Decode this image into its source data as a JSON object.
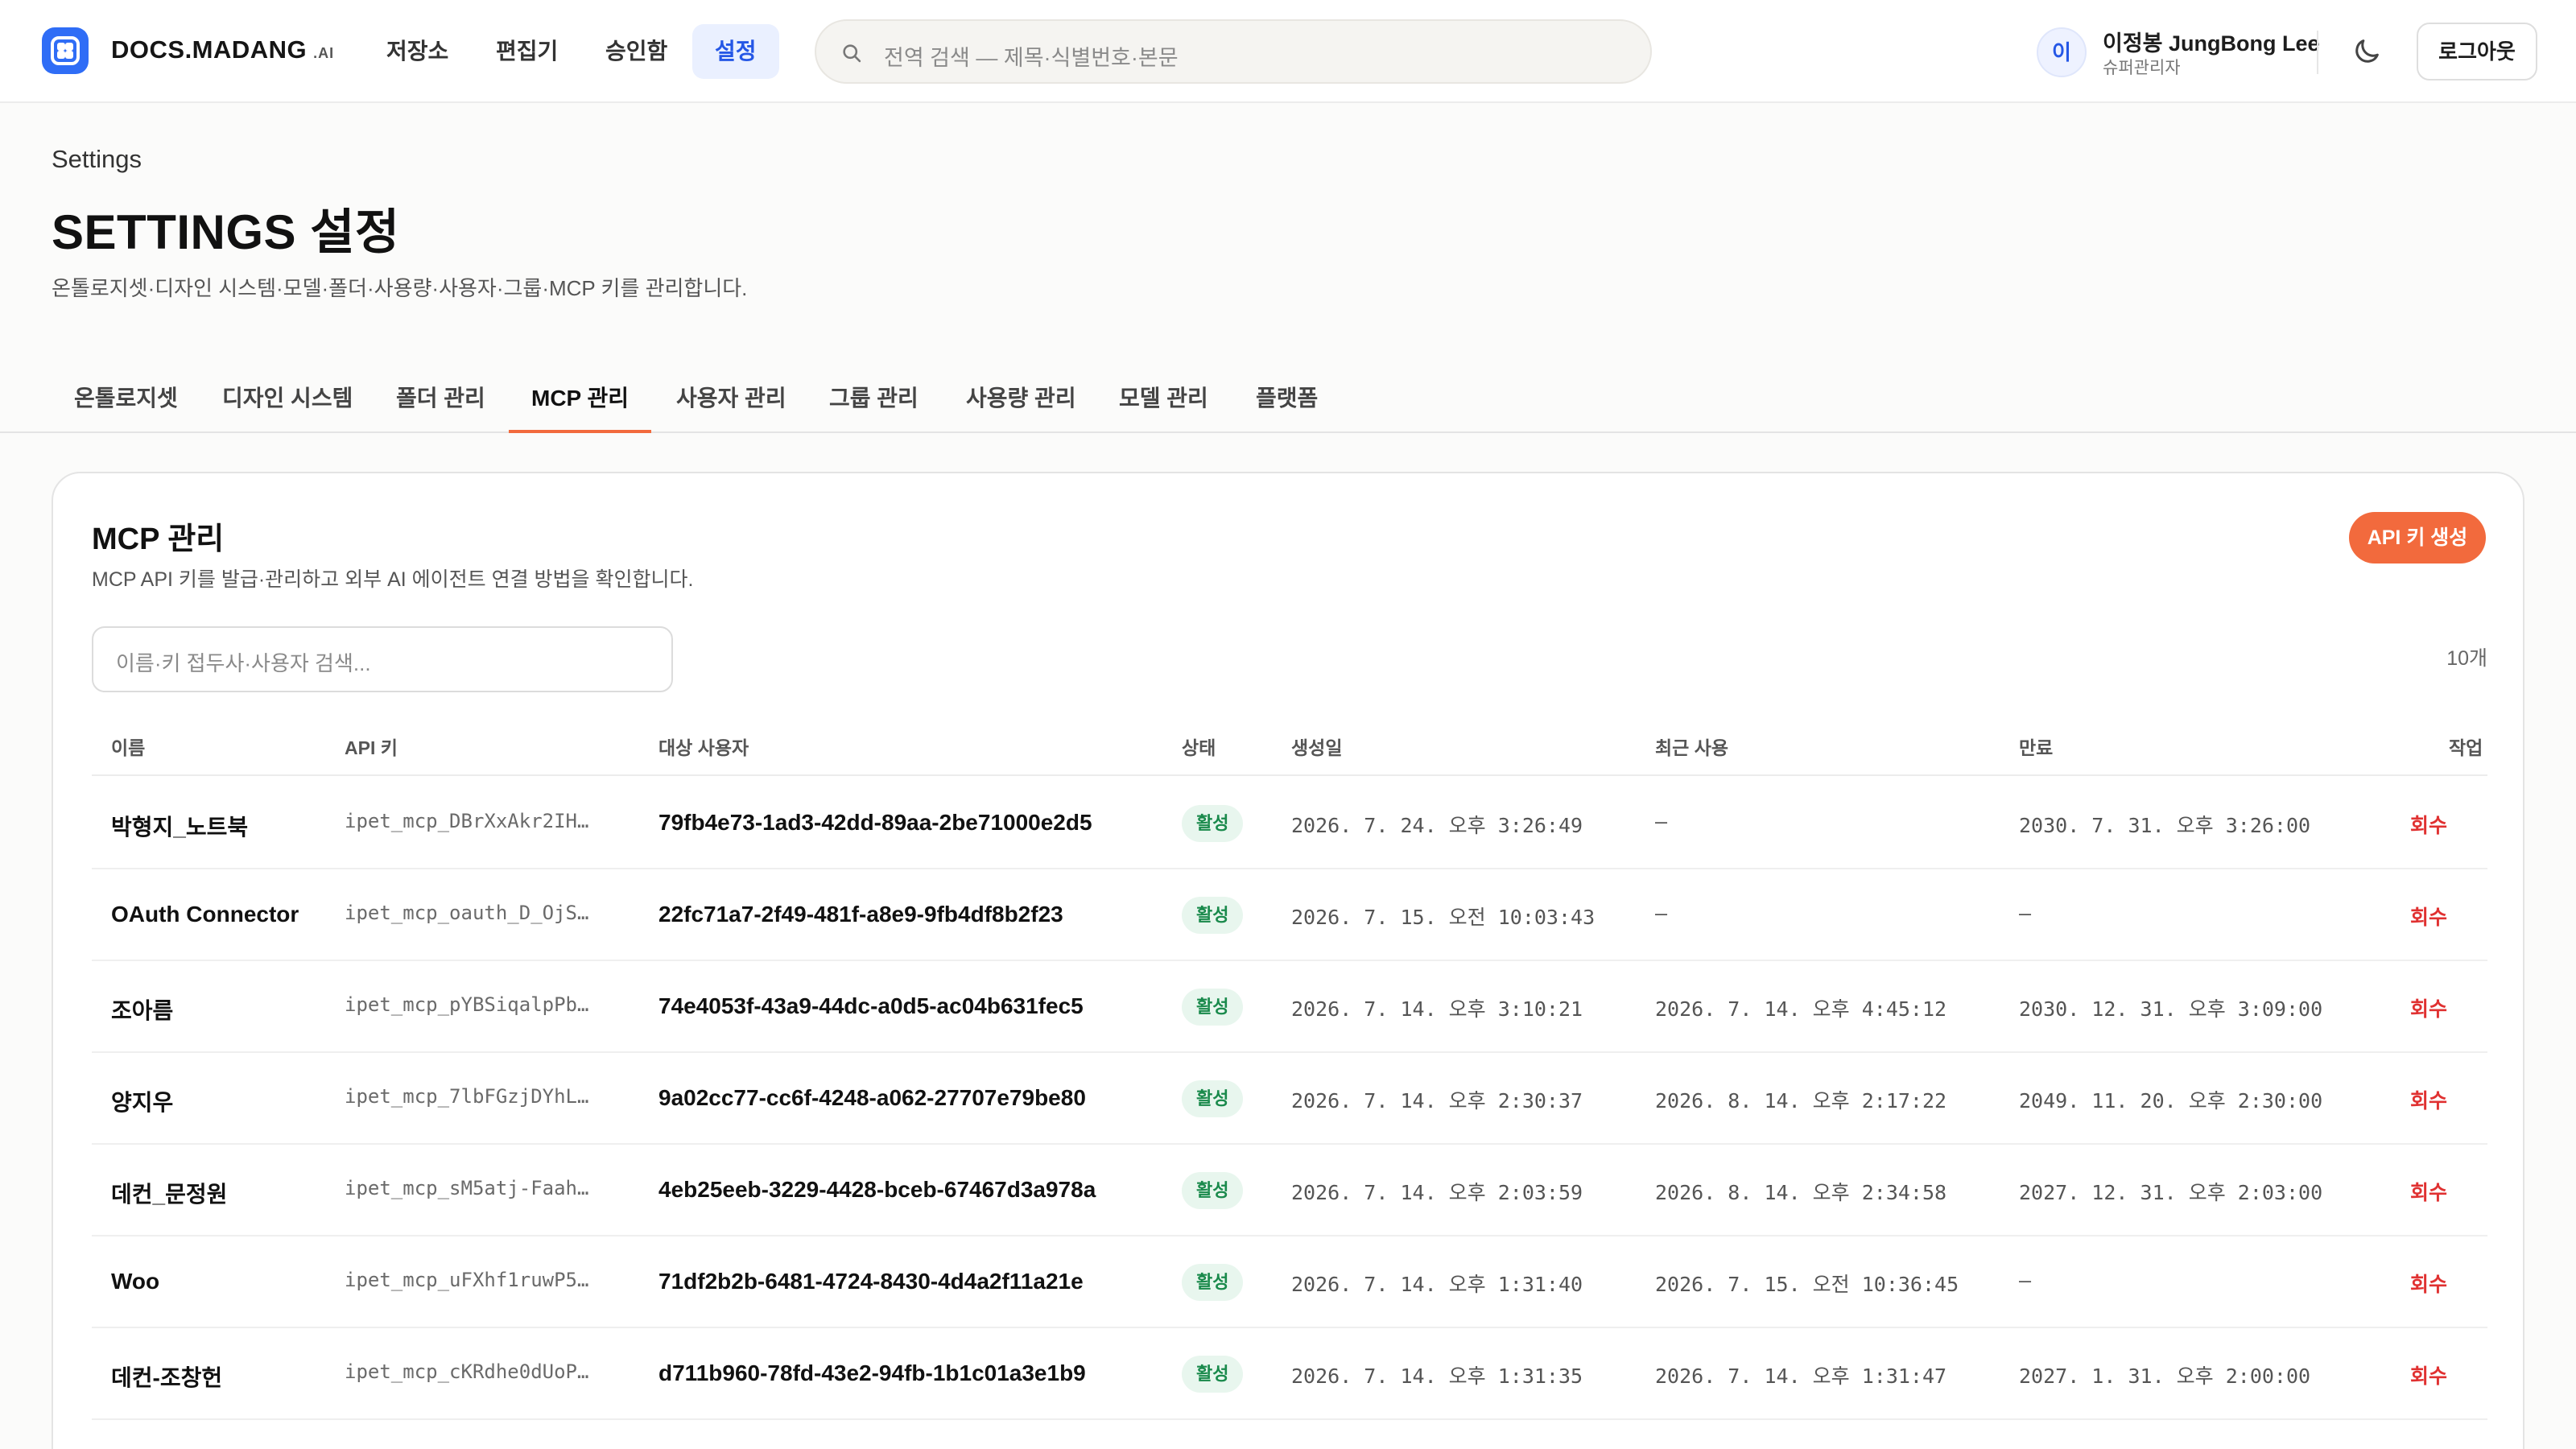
{
  "topnav": {
    "brand": "DOCS.MADANG",
    "brand_suffix": ".AI",
    "items": [
      {
        "label": "저장소"
      },
      {
        "label": "편집기"
      },
      {
        "label": "승인함"
      },
      {
        "label": "설정"
      }
    ],
    "active_item": "설정",
    "search_placeholder": "전역 검색 — 제목·식별번호·본문",
    "user": {
      "avatar_initial": "이",
      "name": "이정봉 JungBong Lee",
      "role": "슈퍼관리자"
    },
    "theme_icon": "moon-icon",
    "logout_label": "로그아웃"
  },
  "header": {
    "breadcrumb": "Settings",
    "title": "SETTINGS 설정",
    "description": "온톨로지셋·디자인 시스템·모델·폴더·사용량·사용자·그룹·MCP 키를 관리합니다."
  },
  "tabs": [
    {
      "label": "온톨로지셋"
    },
    {
      "label": "디자인 시스템"
    },
    {
      "label": "폴더 관리"
    },
    {
      "label": "MCP 관리"
    },
    {
      "label": "사용자 관리"
    },
    {
      "label": "그룹 관리"
    },
    {
      "label": "사용량 관리"
    },
    {
      "label": "모델 관리"
    },
    {
      "label": "플랫폼"
    }
  ],
  "active_tab": "MCP 관리",
  "panel": {
    "title": "MCP 관리",
    "description": "MCP API 키를 발급·관리하고 외부 AI 에이전트 연결 방법을 확인합니다.",
    "create_button": "API 키 생성",
    "filter_placeholder": "이름·키 접두사·사용자 검색...",
    "count": "10개",
    "columns": {
      "name": "이름",
      "key": "API 키",
      "user": "대상 사용자",
      "status": "상태",
      "created": "생성일",
      "last_used": "최근 사용",
      "expires": "만료",
      "action": "작업"
    },
    "rows": [
      {
        "name": "박형지_노트북",
        "key": "ipet_mcp_DBrXxAkr2IH…",
        "user": "79fb4e73-1ad3-42dd-89aa-2be71000e2d5",
        "status": "활성",
        "created": "2026. 7. 24. 오후 3:26:49",
        "last_used": "—",
        "expires": "2030. 7. 31. 오후 3:26:00",
        "action": "회수"
      },
      {
        "name": "OAuth Connector",
        "key": "ipet_mcp_oauth_D_OjS…",
        "user": "22fc71a7-2f49-481f-a8e9-9fb4df8b2f23",
        "status": "활성",
        "created": "2026. 7. 15. 오전 10:03:43",
        "last_used": "—",
        "expires": "—",
        "action": "회수"
      },
      {
        "name": "조아름",
        "key": "ipet_mcp_pYBSiqalpPb…",
        "user": "74e4053f-43a9-44dc-a0d5-ac04b631fec5",
        "status": "활성",
        "created": "2026. 7. 14. 오후 3:10:21",
        "last_used": "2026. 7. 14. 오후 4:45:12",
        "expires": "2030. 12. 31. 오후 3:09:00",
        "action": "회수"
      },
      {
        "name": "양지우",
        "key": "ipet_mcp_7lbFGzjDYhL…",
        "user": "9a02cc77-cc6f-4248-a062-27707e79be80",
        "status": "활성",
        "created": "2026. 7. 14. 오후 2:30:37",
        "last_used": "2026. 8. 14. 오후 2:17:22",
        "expires": "2049. 11. 20. 오후 2:30:00",
        "action": "회수"
      },
      {
        "name": "데컨_문정원",
        "key": "ipet_mcp_sM5atj-Faah…",
        "user": "4eb25eeb-3229-4428-bceb-67467d3a978a",
        "status": "활성",
        "created": "2026. 7. 14. 오후 2:03:59",
        "last_used": "2026. 8. 14. 오후 2:34:58",
        "expires": "2027. 12. 31. 오후 2:03:00",
        "action": "회수"
      },
      {
        "name": "Woo",
        "key": "ipet_mcp_uFXhf1ruwP5…",
        "user": "71df2b2b-6481-4724-8430-4d4a2f11a21e",
        "status": "활성",
        "created": "2026. 7. 14. 오후 1:31:40",
        "last_used": "2026. 7. 15. 오전 10:36:45",
        "expires": "—",
        "action": "회수"
      },
      {
        "name": "데컨-조창헌",
        "key": "ipet_mcp_cKRdhe0dUoP…",
        "user": "d711b960-78fd-43e2-94fb-1b1c01a3e1b9",
        "status": "활성",
        "created": "2026. 7. 14. 오후 1:31:35",
        "last_used": "2026. 7. 14. 오후 1:31:47",
        "expires": "2027. 1. 31. 오후 2:00:00",
        "action": "회수"
      }
    ]
  },
  "colors": {
    "accent": "#2f6df6",
    "primary_action": "#f26a3d",
    "status_active_bg": "#e8f6ee",
    "status_active_text": "#1a8a4c",
    "revoke": "#e03131"
  }
}
